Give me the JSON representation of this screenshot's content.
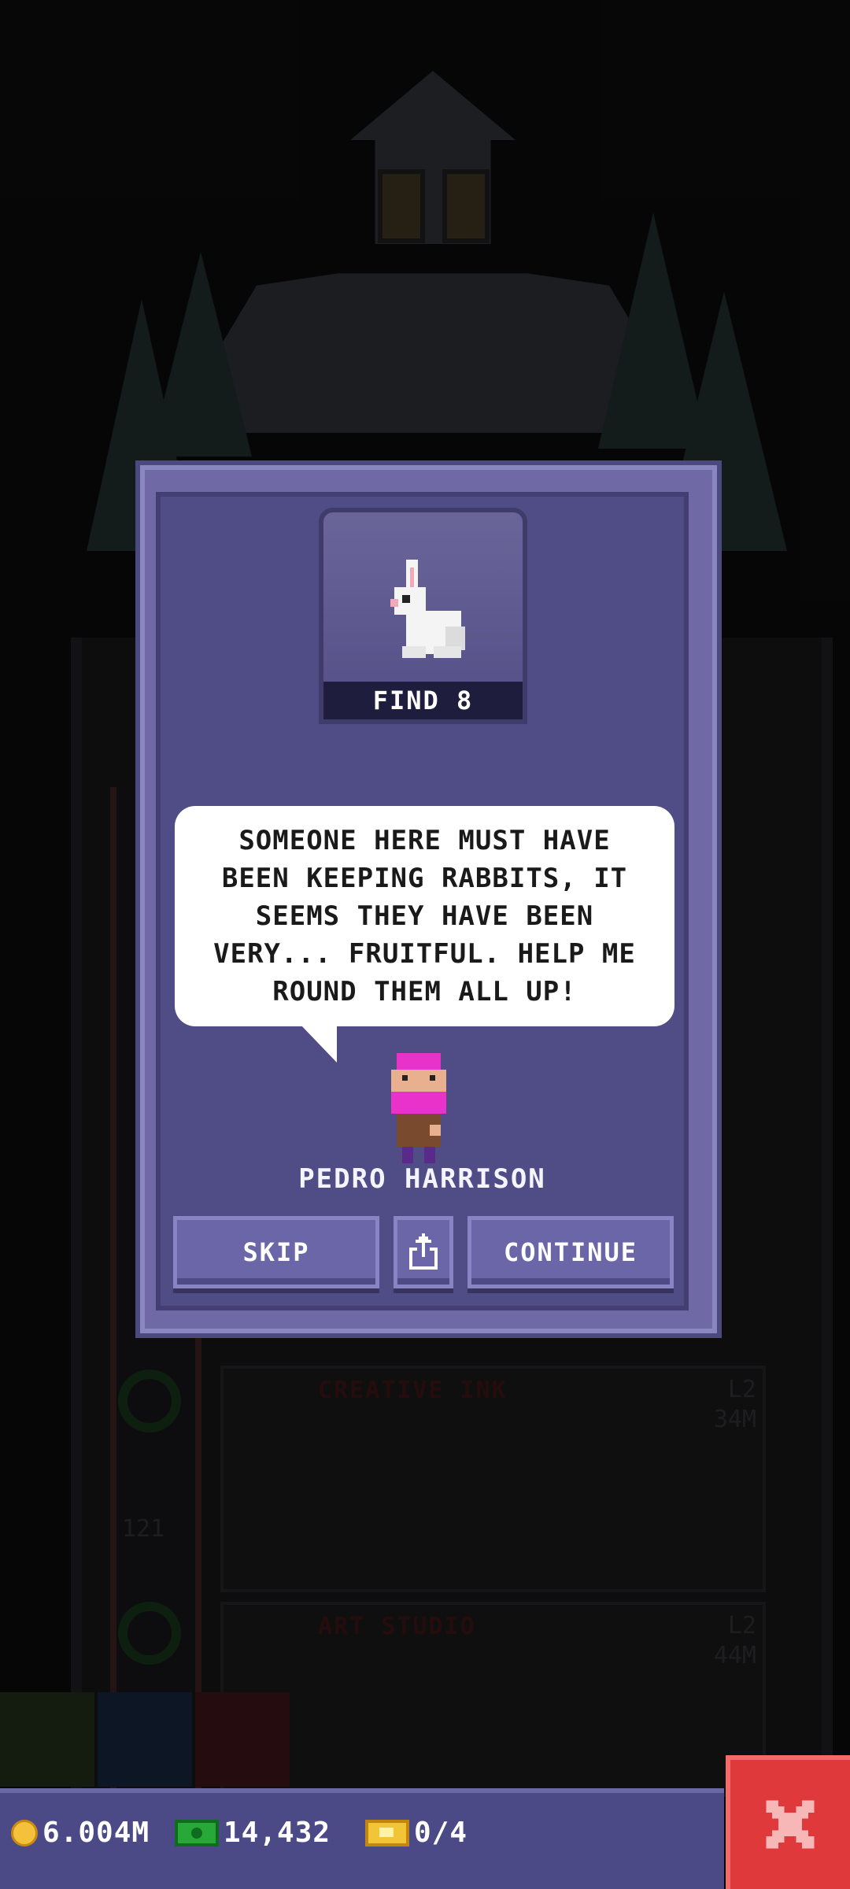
{
  "card": {
    "find_label": "FIND 8"
  },
  "dialog": {
    "message": "SOMEONE HERE MUST HAVE BEEN KEEPING RABBITS, IT SEEMS THEY HAVE BEEN VERY... FRUITFUL. HELP ME ROUND THEM ALL UP!",
    "speaker_name": "PEDRO HARRISON",
    "skip_label": "SKIP",
    "continue_label": "CONTINUE",
    "share_icon": "share-icon"
  },
  "background": {
    "floors": [
      {
        "name": "CREATIVE INK",
        "level": "L2",
        "value": "34M"
      },
      {
        "name": "ART STUDIO",
        "level": "L2",
        "value": "44M"
      }
    ],
    "elevator_numbers": [
      "121"
    ]
  },
  "statusbar": {
    "coins": "6.004M",
    "bux": "14,432",
    "tickets": "0/4"
  },
  "colors": {
    "dialog_bg": "#4f4c86",
    "button_bg": "#6a66a8",
    "close_red": "#e0393c",
    "npc_pink": "#e832c9"
  }
}
